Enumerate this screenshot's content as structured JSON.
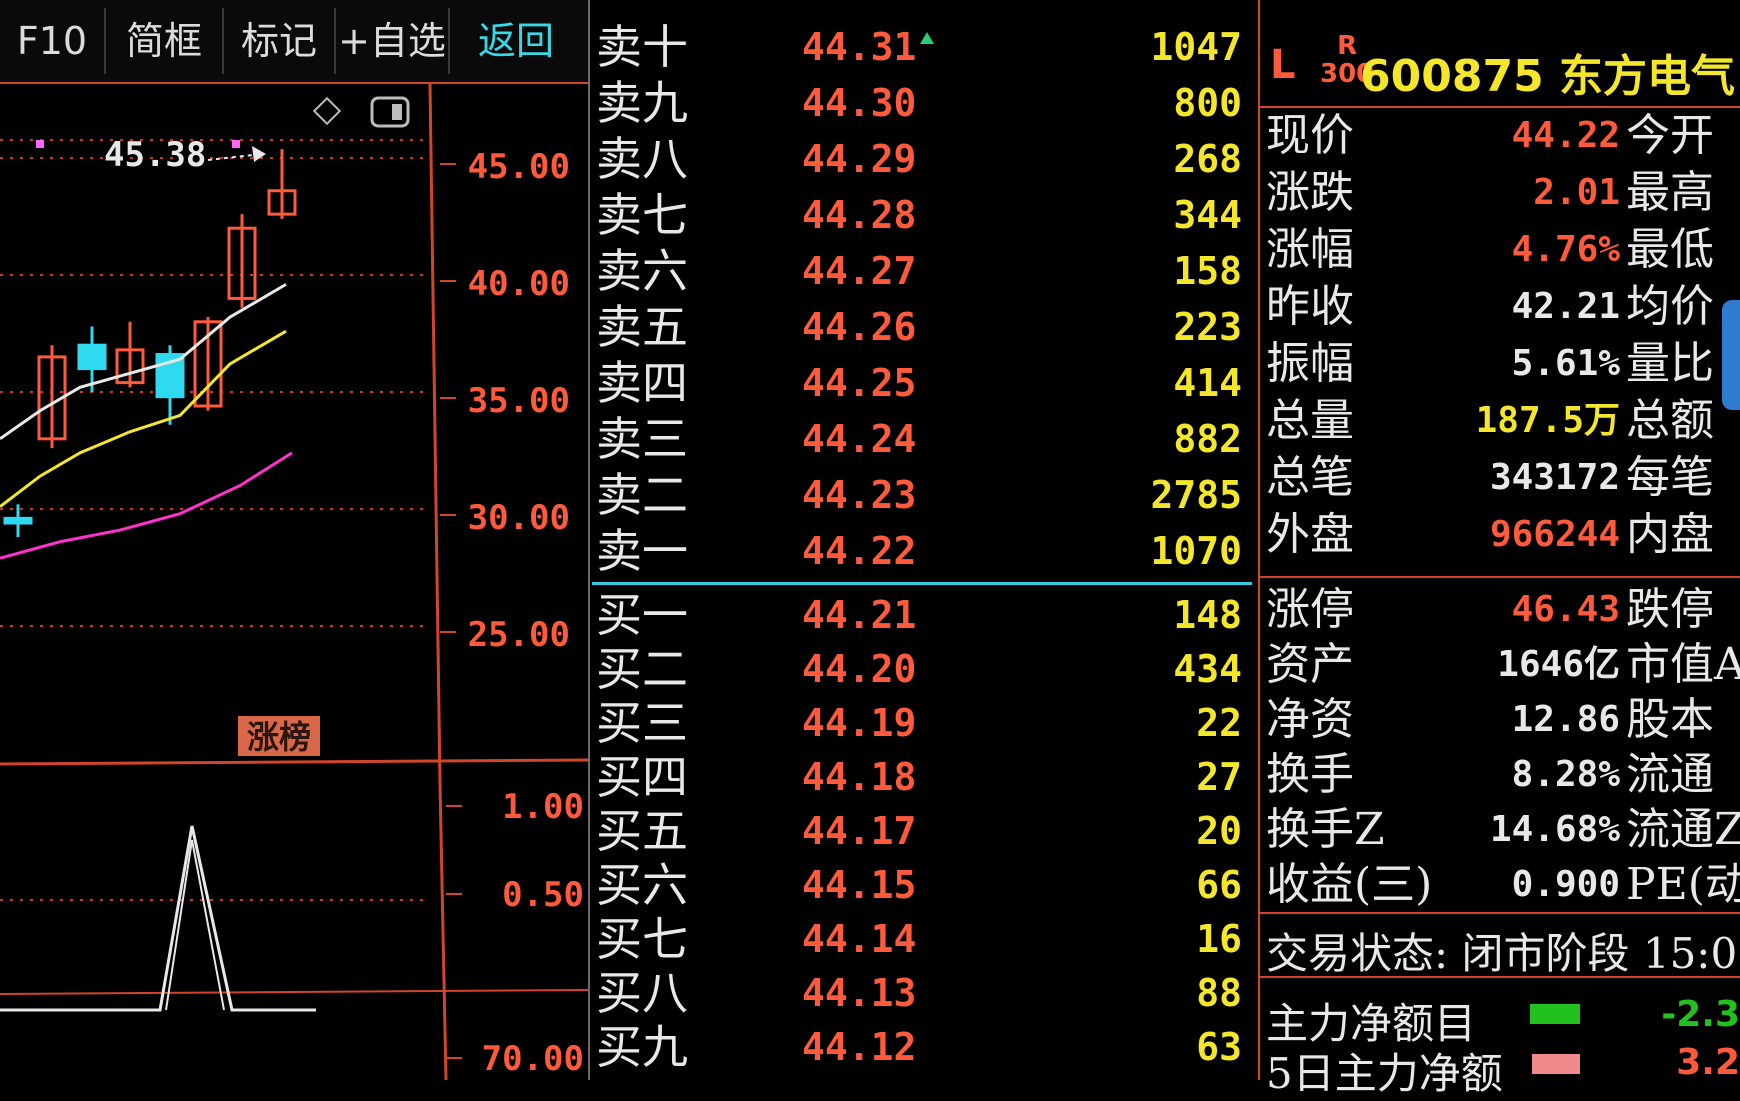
{
  "toolbar": {
    "f10": "F10",
    "simple": "简框",
    "mark": "标记",
    "add_watch": "+自选",
    "back": "返回"
  },
  "chart": {
    "price_ticks": [
      "45.00",
      "40.00",
      "35.00",
      "30.00",
      "25.00"
    ],
    "volume_ticks": [
      "1.00",
      "0.50",
      "70.00"
    ],
    "high_label": "45.38",
    "tag": "涨榜",
    "colors": {
      "up": "#ff5a3c",
      "down": "#2fd9ef",
      "ma1": "#e8e8e8",
      "ma2": "#f3e62b",
      "ma3": "#ff33cc",
      "axis": "#d2452b"
    }
  },
  "book": {
    "asks": [
      {
        "label": "卖十",
        "price": "44.31",
        "vol": "1047"
      },
      {
        "label": "卖九",
        "price": "44.30",
        "vol": "800"
      },
      {
        "label": "卖八",
        "price": "44.29",
        "vol": "268"
      },
      {
        "label": "卖七",
        "price": "44.28",
        "vol": "344"
      },
      {
        "label": "卖六",
        "price": "44.27",
        "vol": "158"
      },
      {
        "label": "卖五",
        "price": "44.26",
        "vol": "223"
      },
      {
        "label": "卖四",
        "price": "44.25",
        "vol": "414"
      },
      {
        "label": "卖三",
        "price": "44.24",
        "vol": "882"
      },
      {
        "label": "卖二",
        "price": "44.23",
        "vol": "2785"
      },
      {
        "label": "卖一",
        "price": "44.22",
        "vol": "1070"
      }
    ],
    "bids": [
      {
        "label": "买一",
        "price": "44.21",
        "vol": "148"
      },
      {
        "label": "买二",
        "price": "44.20",
        "vol": "434"
      },
      {
        "label": "买三",
        "price": "44.19",
        "vol": "22"
      },
      {
        "label": "买四",
        "price": "44.18",
        "vol": "27"
      },
      {
        "label": "买五",
        "price": "44.17",
        "vol": "20"
      },
      {
        "label": "买六",
        "price": "44.15",
        "vol": "66"
      },
      {
        "label": "买七",
        "price": "44.14",
        "vol": "16"
      },
      {
        "label": "买八",
        "price": "44.13",
        "vol": "88"
      },
      {
        "label": "买九",
        "price": "44.12",
        "vol": "63"
      }
    ]
  },
  "quote": {
    "market_l": "L",
    "market_r": "R",
    "market_r_sub": "300",
    "title": "600875 东方电气",
    "rows": [
      {
        "k": "现价",
        "v": "44.22",
        "c": "#ff5a3c",
        "k2": "今开"
      },
      {
        "k": "涨跌",
        "v": "2.01",
        "c": "#ff5a3c",
        "k2": "最高"
      },
      {
        "k": "涨幅",
        "v": "4.76%",
        "c": "#ff5a3c",
        "k2": "最低"
      },
      {
        "k": "昨收",
        "v": "42.21",
        "c": "#e8e8e8",
        "k2": "均价"
      },
      {
        "k": "振幅",
        "v": "5.61%",
        "c": "#e8e8e8",
        "k2": "量比"
      },
      {
        "k": "总量",
        "v": "187.5万",
        "c": "#f3e62b",
        "k2": "总额"
      },
      {
        "k": "总笔",
        "v": "343172",
        "c": "#e8e8e8",
        "k2": "每笔"
      },
      {
        "k": "外盘",
        "v": "966244",
        "c": "#ff5a3c",
        "k2": "内盘"
      }
    ],
    "rows2": [
      {
        "k": "涨停",
        "v": "46.43",
        "c": "#ff5a3c",
        "k2": "跌停"
      },
      {
        "k": "资产",
        "v": "1646亿",
        "c": "#e8e8e8",
        "k2": "市值A"
      },
      {
        "k": "净资",
        "v": "12.86",
        "c": "#e8e8e8",
        "k2": "股本"
      },
      {
        "k": "换手",
        "v": "8.28%",
        "c": "#e8e8e8",
        "k2": "流通"
      },
      {
        "k": "换手Z",
        "v": "14.68%",
        "c": "#e8e8e8",
        "k2": "流通Z"
      },
      {
        "k": "收益(三)",
        "v": "0.900",
        "c": "#e8e8e8",
        "k2": "PE(动)"
      }
    ],
    "status": "交易状态: 闭市阶段 15:0",
    "flow1_label": "主力净额目",
    "flow1_value": "-2.3",
    "flow2_label": "5日主力净额",
    "flow2_value": "3.2"
  }
}
